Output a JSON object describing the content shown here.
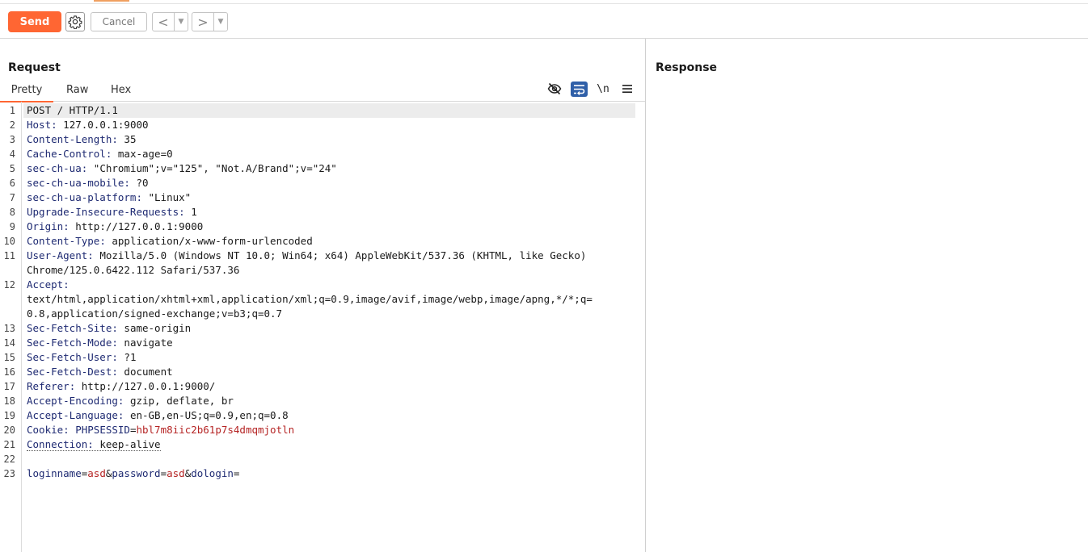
{
  "toolbar": {
    "send_label": "Send",
    "cancel_label": "Cancel",
    "back_glyph": "<",
    "forward_glyph": ">",
    "dropdown_glyph": "▼"
  },
  "request": {
    "title": "Request",
    "tabs": [
      "Pretty",
      "Raw",
      "Hex"
    ],
    "newline_toggle": "\\n",
    "line_numbers": [
      "1",
      "2",
      "3",
      "4",
      "5",
      "6",
      "7",
      "8",
      "9",
      "10",
      "11",
      "12",
      "13",
      "14",
      "15",
      "16",
      "17",
      "18",
      "19",
      "20",
      "21",
      "22",
      "23"
    ],
    "lines": {
      "l1": "POST / HTTP/1.1",
      "l2k": "Host",
      "l2v": "127.0.0.1:9000",
      "l3k": "Content-Length",
      "l3v": "35",
      "l4k": "Cache-Control",
      "l4v": "max-age=0",
      "l5k": "sec-ch-ua",
      "l5v": "\"Chromium\";v=\"125\", \"Not.A/Brand\";v=\"24\"",
      "l6k": "sec-ch-ua-mobile",
      "l6v": "?0",
      "l7k": "sec-ch-ua-platform",
      "l7v": "\"Linux\"",
      "l8k": "Upgrade-Insecure-Requests",
      "l8v": "1",
      "l9k": "Origin",
      "l9v": "http://127.0.0.1:9000",
      "l10k": "Content-Type",
      "l10v": "application/x-www-form-urlencoded",
      "l11k": "User-Agent",
      "l11v": "Mozilla/5.0 (Windows NT 10.0; Win64; x64) AppleWebKit/537.36 (KHTML, like Gecko)",
      "l11c": "Chrome/125.0.6422.112 Safari/537.36",
      "l12k": "Accept",
      "l12a": "text/html,application/xhtml+xml,application/xml;q=0.9,image/avif,image/webp,image/apng,*/*;q=",
      "l12b": "0.8,application/signed-exchange;v=b3;q=0.7",
      "l13k": "Sec-Fetch-Site",
      "l13v": "same-origin",
      "l14k": "Sec-Fetch-Mode",
      "l14v": "navigate",
      "l15k": "Sec-Fetch-User",
      "l15v": "?1",
      "l16k": "Sec-Fetch-Dest",
      "l16v": "document",
      "l17k": "Referer",
      "l17v": "http://127.0.0.1:9000/",
      "l18k": "Accept-Encoding",
      "l18v": "gzip, deflate, br",
      "l19k": "Accept-Language",
      "l19v": "en-GB,en-US;q=0.9,en;q=0.8",
      "l20k": "Cookie",
      "l20n": "PHPSESSID",
      "l20v": "hbl7m8iic2b61p7s4dmqmjotln",
      "l21k": "Connection",
      "l21v": "keep-alive",
      "l23": {
        "p1": "loginname",
        "v1": "asd",
        "p2": "password",
        "v2": "asd",
        "p3": "dologin"
      }
    }
  },
  "response": {
    "title": "Response"
  },
  "colors": {
    "accent": "#ff6633",
    "header_key": "#1e2a72",
    "cookie_value": "#b52424"
  }
}
